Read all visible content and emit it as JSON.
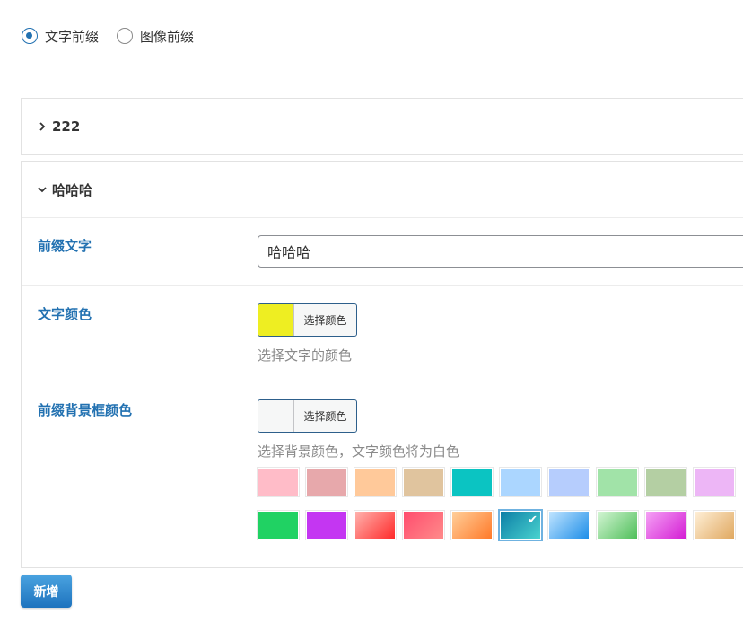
{
  "prefix_type": {
    "options": [
      {
        "label": "文字前缀",
        "checked": true
      },
      {
        "label": "图像前缀",
        "checked": false
      }
    ]
  },
  "panels": [
    {
      "title": "222",
      "expanded": false
    },
    {
      "title": "哈哈哈",
      "expanded": true,
      "fields": {
        "prefix_text": {
          "label": "前缀文字",
          "value": "哈哈哈"
        },
        "text_color": {
          "label": "文字颜色",
          "value": "#eeee22",
          "button_label": "选择颜色",
          "hint": "选择文字的颜色"
        },
        "bg_color": {
          "label": "前缀背景框颜色",
          "value": "#f6f7f7",
          "button_label": "选择颜色",
          "hint": "选择背景颜色，文字颜色将为白色"
        }
      }
    }
  ],
  "presets": {
    "row1": [
      "#ffbcc8",
      "#e7a8ab",
      "#ffc99a",
      "#e0c49e",
      "#0bc4c2",
      "#abd6ff",
      "#b6cdfd",
      "#a1e3a8",
      "#b4cfa3",
      "#edb6f6"
    ],
    "row2": [
      "#20d263",
      "#c436f2",
      "linear-gradient(135deg,#ffb3ae,#ff2a2a)",
      "linear-gradient(135deg,#ff4d6e,#ff8a8a)",
      "linear-gradient(135deg,#ffcf9a,#ff7a2a)",
      "linear-gradient(135deg,#0d7ea6,#49d3cf)",
      "linear-gradient(135deg,#c0e4ff,#1e8ee8)",
      "linear-gradient(135deg,#d4f5d4,#4fbf5a)",
      "linear-gradient(135deg,#f5a3f5,#d41ed4)",
      "linear-gradient(135deg,#fff0d8,#e0a860)"
    ],
    "selected": "row2.5"
  },
  "add_button": {
    "label": "新增"
  }
}
